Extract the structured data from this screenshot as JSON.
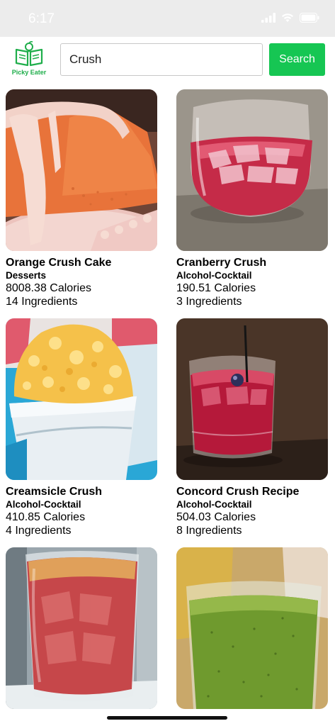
{
  "status": {
    "time": "6:17"
  },
  "header": {
    "logo_text": "Picky Eater",
    "search_value": "Crush",
    "search_button": "Search"
  },
  "recipes": [
    {
      "title": "Orange Crush Cake",
      "category": "Desserts",
      "calories": "8008.38 Calories",
      "ingredients": "14 Ingredients"
    },
    {
      "title": "Cranberry Crush",
      "category": "Alcohol-Cocktail",
      "calories": "190.51 Calories",
      "ingredients": "3 Ingredients"
    },
    {
      "title": "Creamsicle Crush",
      "category": "Alcohol-Cocktail",
      "calories": "410.85 Calories",
      "ingredients": "4 Ingredients"
    },
    {
      "title": "Concord Crush Recipe",
      "category": "Alcohol-Cocktail",
      "calories": "504.03 Calories",
      "ingredients": "8 Ingredients"
    }
  ],
  "colors": {
    "accent": "#16c653",
    "brand": "#1fae4b"
  }
}
